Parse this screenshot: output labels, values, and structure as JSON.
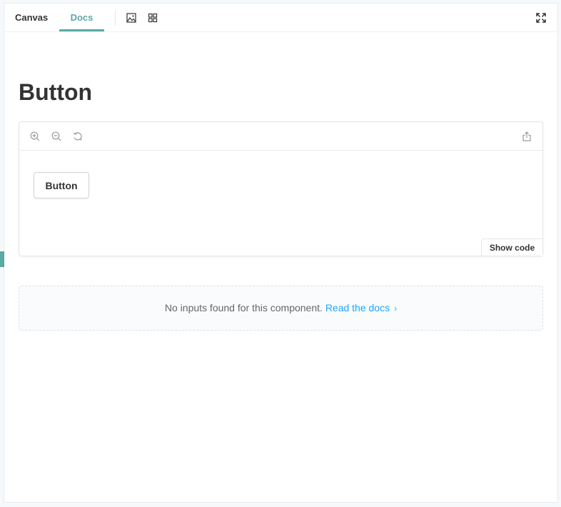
{
  "tabs": {
    "canvas": "Canvas",
    "docs": "Docs"
  },
  "toolbar": {
    "icons": [
      "image-icon",
      "grid-icon",
      "fullscreen-icon"
    ]
  },
  "docs": {
    "title": "Button",
    "preview": {
      "icons": [
        "zoom-in-icon",
        "zoom-out-icon",
        "reset-zoom-icon",
        "share-icon"
      ],
      "sample_button_label": "Button",
      "show_code_label": "Show code"
    },
    "no_inputs": {
      "message": "No inputs found for this component.",
      "link_text": "Read the docs",
      "link_chevron": "›"
    }
  },
  "colors": {
    "accent": "#5aaaa4",
    "link": "#1ea7fd",
    "text": "#333333"
  }
}
